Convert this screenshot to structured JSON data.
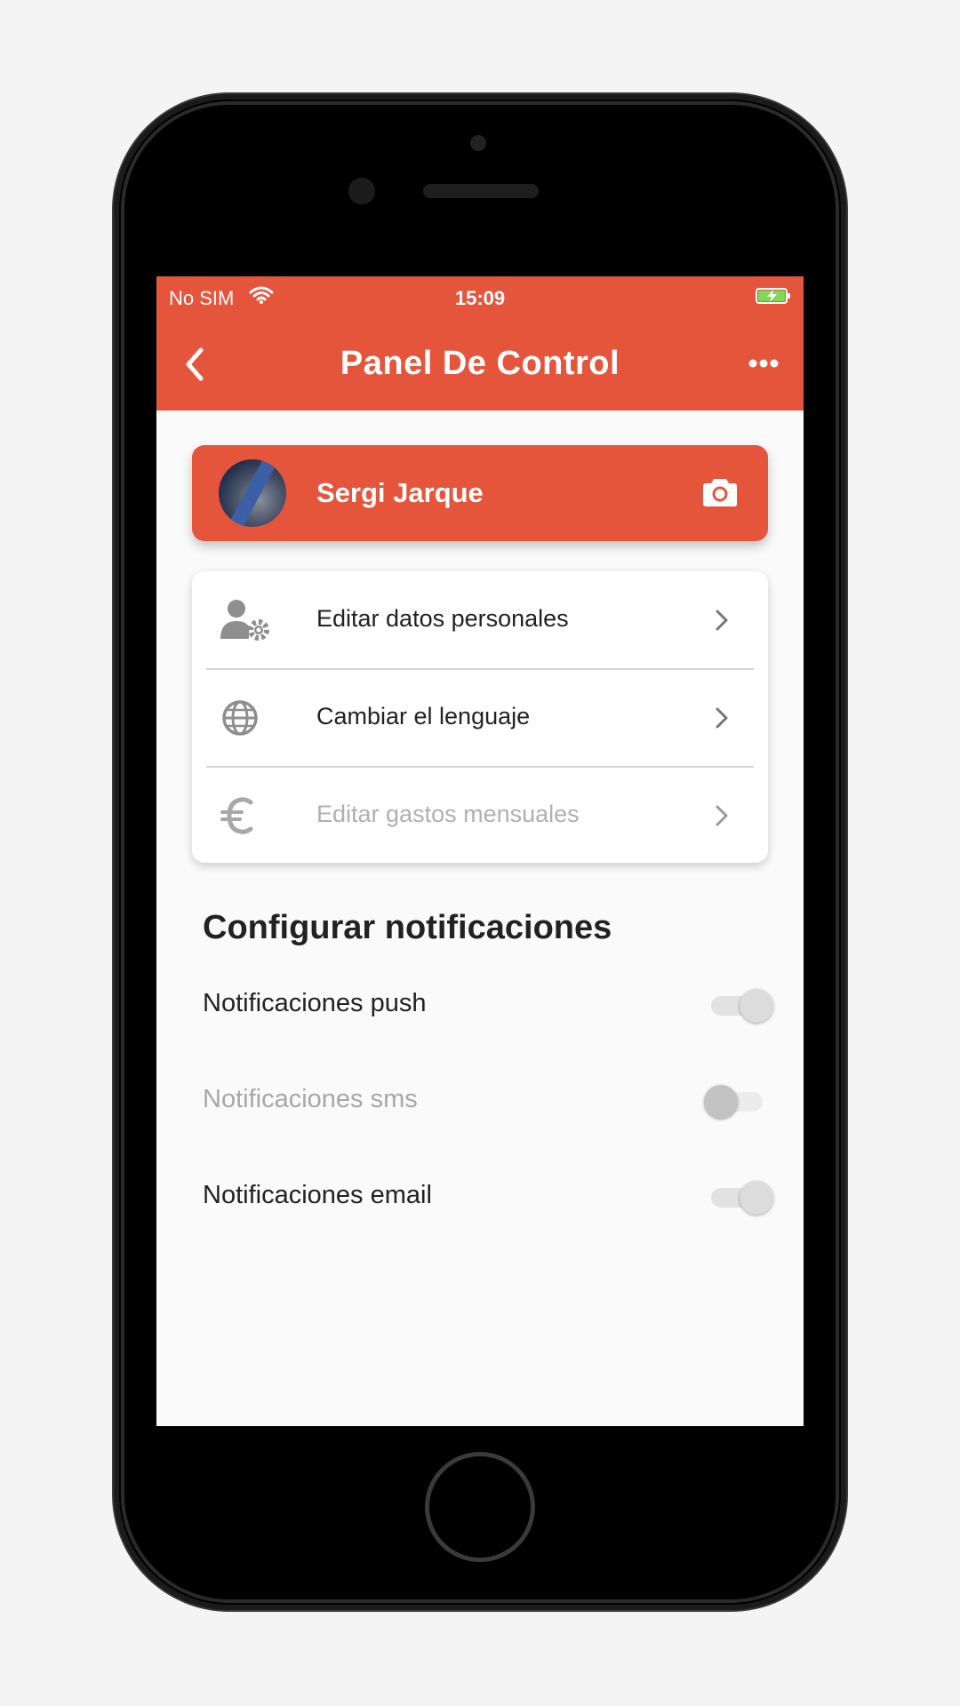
{
  "status_bar": {
    "carrier": "No SIM",
    "time": "15:09"
  },
  "header": {
    "title": "Panel De Control"
  },
  "profile": {
    "name": "Sergi Jarque"
  },
  "menu": [
    {
      "label": "Editar datos personales",
      "icon": "user-gear-icon",
      "enabled": true
    },
    {
      "label": "Cambiar el lenguaje",
      "icon": "globe-icon",
      "enabled": true
    },
    {
      "label": "Editar gastos mensuales",
      "icon": "euro-icon",
      "enabled": false
    }
  ],
  "notifications": {
    "title": "Configurar notificaciones",
    "items": [
      {
        "label": "Notificaciones push",
        "on": true,
        "enabled": true
      },
      {
        "label": "Notificaciones sms",
        "on": false,
        "enabled": false
      },
      {
        "label": "Notificaciones email",
        "on": true,
        "enabled": true
      }
    ]
  },
  "colors": {
    "accent": "#e4553c",
    "background": "#fafafa",
    "disabled_text": "#b0b0b0"
  }
}
